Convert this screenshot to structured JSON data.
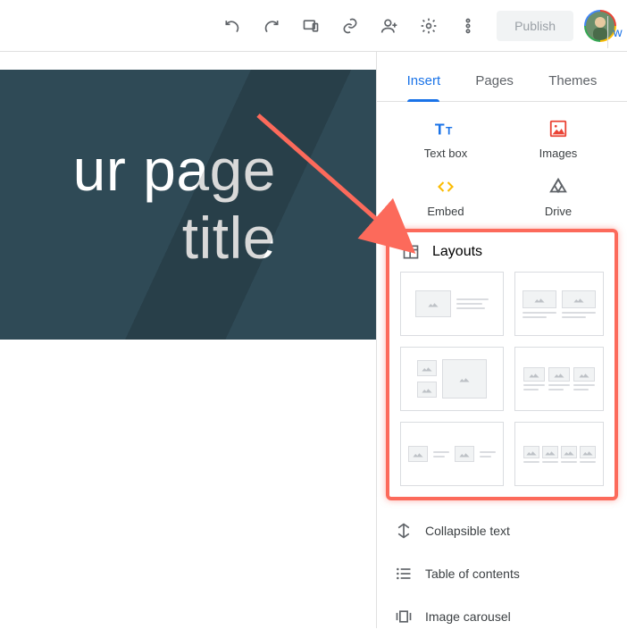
{
  "toolbar": {
    "publish_label": "Publish",
    "trailing_letter": "w"
  },
  "hero": {
    "title_line1": "ur page",
    "title_line2": "title"
  },
  "panel": {
    "tabs": {
      "insert": "Insert",
      "pages": "Pages",
      "themes": "Themes"
    },
    "insert_items": {
      "textbox": "Text box",
      "images": "Images",
      "embed": "Embed",
      "drive": "Drive"
    },
    "layouts_label": "Layouts",
    "rows": {
      "collapsible": "Collapsible text",
      "toc": "Table of contents",
      "carousel": "Image carousel"
    }
  }
}
